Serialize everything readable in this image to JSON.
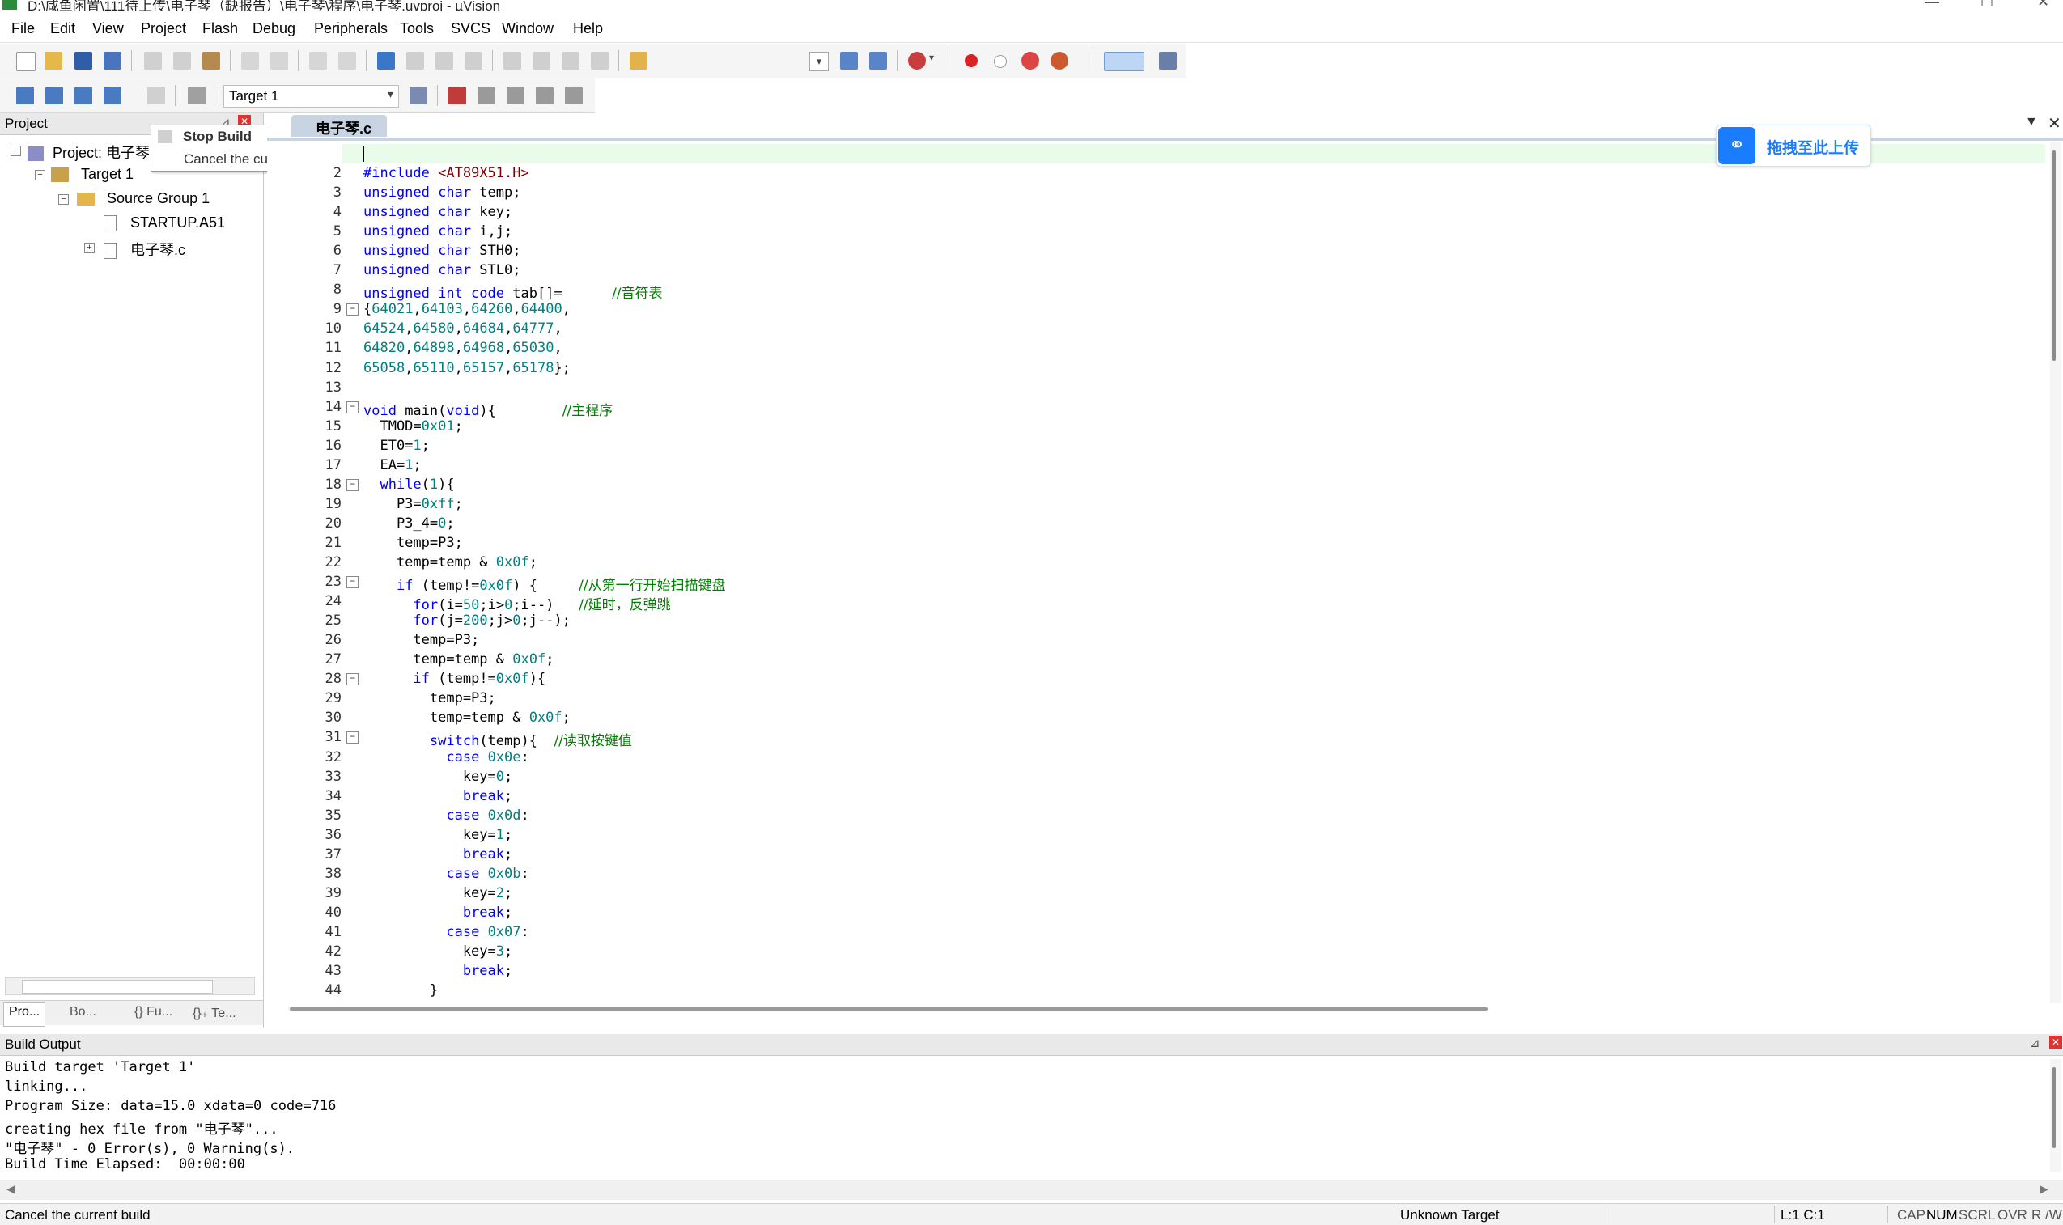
{
  "window": {
    "title": "D:\\咸鱼闲置\\111待上传\\电子琴（缺报告）\\电子琴\\程序\\电子琴.uvproj - µVision"
  },
  "menu": [
    "File",
    "Edit",
    "View",
    "Project",
    "Flash",
    "Debug",
    "Peripherals",
    "Tools",
    "SVCS",
    "Window",
    "Help"
  ],
  "build_toolbar": {
    "target_select": "Target 1"
  },
  "project_panel": {
    "header": "Project",
    "tree": {
      "project": "Project: 电子琴",
      "target": "Target 1",
      "group": "Source Group 1",
      "files": [
        "STARTUP.A51",
        "电子琴.c"
      ]
    },
    "tabs": [
      "Pro...",
      "Bo...",
      "{} Fu...",
      "{}₊ Te..."
    ]
  },
  "tooltip": {
    "title": "Stop Build",
    "desc": "Cancel the current build"
  },
  "editor": {
    "tab": "电子琴.c",
    "upload_badge": "拖拽至此上传",
    "lines": [
      {
        "n": "2",
        "code": "<span class='kw'>#include</span> <span class='str'>&lt;AT89X51.H&gt;</span>"
      },
      {
        "n": "3",
        "code": "<span class='kw'>unsigned char</span> temp;"
      },
      {
        "n": "4",
        "code": "<span class='kw'>unsigned char</span> key;"
      },
      {
        "n": "5",
        "code": "<span class='kw'>unsigned char</span> i,j;"
      },
      {
        "n": "6",
        "code": "<span class='kw'>unsigned char</span> STH0;"
      },
      {
        "n": "7",
        "code": "<span class='kw'>unsigned char</span> STL0;"
      },
      {
        "n": "8",
        "code": "<span class='kw'>unsigned int code</span> tab[]=      <span class='cm'>//音符表</span>"
      },
      {
        "n": "9",
        "fold": "−",
        "code": "{<span class='num'>64021</span>,<span class='num'>64103</span>,<span class='num'>64260</span>,<span class='num'>64400</span>,"
      },
      {
        "n": "10",
        "code": "<span class='num'>64524</span>,<span class='num'>64580</span>,<span class='num'>64684</span>,<span class='num'>64777</span>,"
      },
      {
        "n": "11",
        "code": "<span class='num'>64820</span>,<span class='num'>64898</span>,<span class='num'>64968</span>,<span class='num'>65030</span>,"
      },
      {
        "n": "12",
        "code": "<span class='num'>65058</span>,<span class='num'>65110</span>,<span class='num'>65157</span>,<span class='num'>65178</span>};"
      },
      {
        "n": "13",
        "code": ""
      },
      {
        "n": "14",
        "fold": "−",
        "code": "<span class='kw'>void</span> main(<span class='kw'>void</span>){        <span class='cm'>//主程序</span>"
      },
      {
        "n": "15",
        "code": "  TMOD=<span class='num'>0x01</span>;"
      },
      {
        "n": "16",
        "code": "  ET0=<span class='num'>1</span>;"
      },
      {
        "n": "17",
        "code": "  EA=<span class='num'>1</span>;"
      },
      {
        "n": "18",
        "fold": "−",
        "code": "  <span class='kw'>while</span>(<span class='num'>1</span>){"
      },
      {
        "n": "19",
        "code": "    P3=<span class='num'>0xff</span>;"
      },
      {
        "n": "20",
        "code": "    P3_4=<span class='num'>0</span>;"
      },
      {
        "n": "21",
        "code": "    temp=P3;"
      },
      {
        "n": "22",
        "code": "    temp=temp &amp; <span class='num'>0x0f</span>;"
      },
      {
        "n": "23",
        "fold": "−",
        "code": "    <span class='kw'>if</span> (temp!=<span class='num'>0x0f</span>) {     <span class='cm'>//从第一行开始扫描键盘</span>"
      },
      {
        "n": "24",
        "code": "      <span class='kw'>for</span>(i=<span class='num'>50</span>;i&gt;<span class='num'>0</span>;i--)   <span class='cm'>//延时，反弹跳</span>"
      },
      {
        "n": "25",
        "code": "      <span class='kw'>for</span>(j=<span class='num'>200</span>;j&gt;<span class='num'>0</span>;j--);"
      },
      {
        "n": "26",
        "code": "      temp=P3;"
      },
      {
        "n": "27",
        "code": "      temp=temp &amp; <span class='num'>0x0f</span>;"
      },
      {
        "n": "28",
        "fold": "−",
        "code": "      <span class='kw'>if</span> (temp!=<span class='num'>0x0f</span>){"
      },
      {
        "n": "29",
        "code": "        temp=P3;"
      },
      {
        "n": "30",
        "code": "        temp=temp &amp; <span class='num'>0x0f</span>;"
      },
      {
        "n": "31",
        "fold": "−",
        "code": "        <span class='kw'>switch</span>(temp){  <span class='cm'>//读取按键值</span>"
      },
      {
        "n": "32",
        "code": "          <span class='kw'>case</span> <span class='num'>0x0e</span>:"
      },
      {
        "n": "33",
        "code": "            key=<span class='num'>0</span>;"
      },
      {
        "n": "34",
        "code": "            <span class='kw'>break</span>;"
      },
      {
        "n": "35",
        "code": "          <span class='kw'>case</span> <span class='num'>0x0d</span>:"
      },
      {
        "n": "36",
        "code": "            key=<span class='num'>1</span>;"
      },
      {
        "n": "37",
        "code": "            <span class='kw'>break</span>;"
      },
      {
        "n": "38",
        "code": "          <span class='kw'>case</span> <span class='num'>0x0b</span>:"
      },
      {
        "n": "39",
        "code": "            key=<span class='num'>2</span>;"
      },
      {
        "n": "40",
        "code": "            <span class='kw'>break</span>;"
      },
      {
        "n": "41",
        "code": "          <span class='kw'>case</span> <span class='num'>0x07</span>:"
      },
      {
        "n": "42",
        "code": "            key=<span class='num'>3</span>;"
      },
      {
        "n": "43",
        "code": "            <span class='kw'>break</span>;"
      },
      {
        "n": "44",
        "code": "        }"
      }
    ]
  },
  "build_output": {
    "header": "Build Output",
    "lines": [
      "Build target 'Target 1'",
      "linking...",
      "Program Size: data=15.0 xdata=0 code=716",
      "creating hex file from \"电子琴\"...",
      "\"电子琴\" - 0 Error(s), 0 Warning(s).",
      "Build Time Elapsed:  00:00:00"
    ]
  },
  "status": {
    "message": "Cancel the current build",
    "target": "Unknown Target",
    "position": "L:1 C:1",
    "indicators": [
      "CAP",
      "NUM",
      "SCRL",
      "OVR",
      "R /W"
    ]
  },
  "colors": {
    "keyword": "#0000ff",
    "number": "#008080",
    "string": "#800000",
    "comment": "#008000",
    "badge": "#1a7cff"
  }
}
